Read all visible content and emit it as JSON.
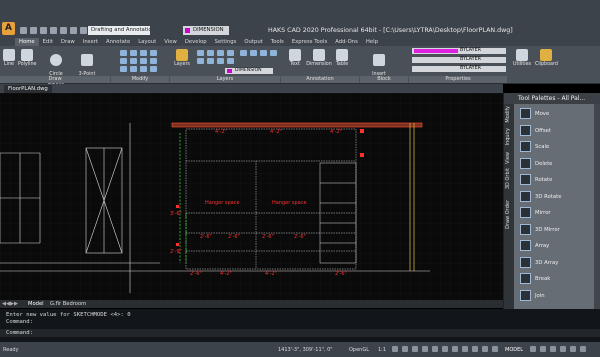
{
  "app": {
    "title": "HAKS CAD 2020 Professional 64bit - [C:\\Users\\LYTRA\\Desktop\\FloorPLAN.dwg]",
    "logo": "A",
    "workspace": "Drafting and Annotation",
    "top_layer": "DIMENSION"
  },
  "ribbon_tabs": [
    "Home",
    "Edit",
    "Draw",
    "Insert",
    "Annotate",
    "Layout",
    "View",
    "Develop",
    "Settings",
    "Output",
    "Tools",
    "Express Tools",
    "Add-Ons",
    "Help"
  ],
  "ribbon": {
    "draw_buttons": [
      "Line",
      "Polyline",
      "Circle\nCenter-Radius",
      "3-Point\nArc"
    ],
    "modify_label": "Modify",
    "draw_label": "Draw",
    "layers_button": "Layers",
    "layers_label": "Layers",
    "layer_combo": "DIMENSION",
    "annotation_buttons": [
      "Text",
      "Dimension",
      "Table"
    ],
    "annotation_label": "Annotation",
    "block_buttons": [
      "Insert\nBlock..."
    ],
    "block_label": "Block",
    "properties": [
      "BYLAYER",
      "BYLAYER",
      "BYLAYER"
    ],
    "properties_label": "Properties",
    "utilities": "Utilities",
    "clipboard": "Clipboard"
  },
  "file_tab": "FloorPLAN.dwg",
  "drawing": {
    "top_dims": [
      "4'-2\"",
      "4'-2\"",
      "4'-2\""
    ],
    "hanger_labels": [
      "Hanger space",
      "Hanger space"
    ],
    "dims_left": [
      "3'-6\"",
      "2'-9\""
    ],
    "bottom_dims": [
      "2'-6\"",
      "4'-2\"",
      "4'-2\"",
      "2'-6\""
    ],
    "row_dims": [
      "2'-6\"",
      "2'-6\"",
      "2'-6\"",
      "2'-6\""
    ]
  },
  "layout_tabs": [
    "Model",
    "G.flr Bedroom"
  ],
  "command": {
    "history": [
      "Enter new value for SKETCHMODE <4>: 0",
      "Command:"
    ],
    "prompt": "Command:"
  },
  "status": {
    "ready": "Ready",
    "coords": "1413'-3\", 309'-11\", 0\"",
    "opengl": "OpenGL",
    "scale": "1:1",
    "model": "MODEL"
  },
  "palette": {
    "title": "Tool Palettes - All Pal...",
    "vertical_tabs": [
      "Modify",
      "Inquiry",
      "View",
      "3D Orbit",
      "Draw Order"
    ],
    "items": [
      "Move",
      "Offset",
      "Scale",
      "Delete",
      "Rotate",
      "3D Rotate",
      "Mirror",
      "3D Mirror",
      "Array",
      "3D Array",
      "Break",
      "Join"
    ]
  },
  "colors": {
    "accent_magenta": "#e020e0",
    "drawing_red": "#ff3030",
    "drawing_green": "#30d030",
    "drawing_white": "#e0e0e0",
    "drawing_yellow": "#e0c040"
  }
}
